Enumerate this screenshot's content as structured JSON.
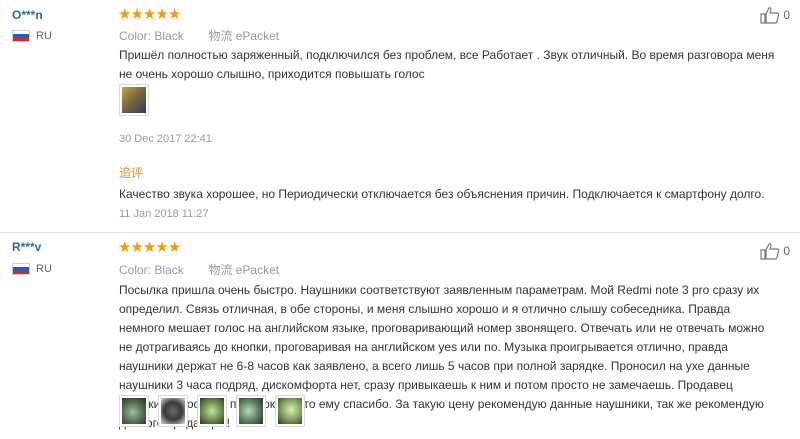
{
  "reviews": [
    {
      "user": "O***n",
      "country": "RU",
      "stars": [
        "★",
        "★",
        "★",
        "★",
        "★"
      ],
      "rating": 5,
      "color_label": "Color:",
      "color_value": "Black",
      "shipping_label": "物流",
      "shipping_value": "ePacket",
      "text": "Пришёл полностью заряженный, подключился без проблем, все Работает . Звук отличный. Во время разговора меня не очень хорошо слышно, приходится повышать голос",
      "photos": [
        {
          "icon": "photo-thumbnail",
          "color": "#7a6a3a"
        }
      ],
      "date": "30 Dec 2017 22:41",
      "followup_label": "追评",
      "followup_text": "Качество звука хорошее, но Периодически отключается без объяснения причин. Подключается к смартфону долго.",
      "followup_date": "11 Jan 2018 11:27",
      "helpful_count": "0"
    },
    {
      "user": "R***v",
      "country": "RU",
      "stars": [
        "★",
        "★",
        "★",
        "★",
        "★"
      ],
      "rating": 5,
      "color_label": "Color:",
      "color_value": "Black",
      "shipping_label": "物流",
      "shipping_value": "ePacket",
      "text": "Посылка пришла очень быстро. Наушники соответствуют заявленным параметрам. Мой Redmi note 3 pro сразу их определил. Связь отличная, в обе стороны, и меня слышно хорошо и я отлично слышу собеседника. Правда немного мешает голос на английском языке, проговаривающий номер звонящего. Отвечать или не отвечать можно не дотрагиваясь до кнопки, проговаривая на английском yes или no. Музыка проигрывается отлично, правда наушники держат не 6-8 часов как заявлено, а всего лишь 5 часов при полной зарядке. Проносил на ухе данные наушники 3 часа подряд, дискомфорта нет, сразу привыкаешь к ним и потом просто не замечаешь. Продавец положил в посылку подарок, за что ему спасибо. За такую цену рекомендую данные наушники, так же рекомендую данного продавца!!!",
      "photos": [
        {
          "icon": "photo-thumbnail",
          "color": "#5a6a4a"
        },
        {
          "icon": "photo-thumbnail",
          "color": "#4a4a4a"
        },
        {
          "icon": "photo-thumbnail",
          "color": "#6a8a4a"
        },
        {
          "icon": "photo-thumbnail",
          "color": "#5a7a5a"
        },
        {
          "icon": "photo-thumbnail",
          "color": "#7a9a5a"
        }
      ],
      "helpful_count": "0"
    }
  ],
  "colors": {
    "username": "#2a6aad",
    "stars": "#f29b05",
    "followup": "#e48a1a",
    "meta": "#999999"
  }
}
